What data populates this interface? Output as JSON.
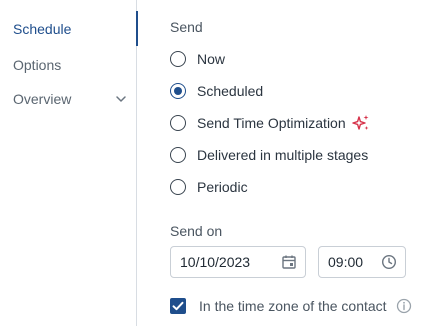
{
  "sidebar": {
    "items": [
      {
        "label": "Schedule",
        "active": true
      },
      {
        "label": "Options",
        "active": false
      },
      {
        "label": "Overview",
        "active": false
      }
    ]
  },
  "send": {
    "label": "Send",
    "options": [
      {
        "label": "Now",
        "checked": false
      },
      {
        "label": "Scheduled",
        "checked": true
      },
      {
        "label": "Send Time Optimization",
        "checked": false,
        "icon": "sparkle-icon"
      },
      {
        "label": "Delivered in multiple stages",
        "checked": false
      },
      {
        "label": "Periodic",
        "checked": false
      }
    ]
  },
  "send_on": {
    "label": "Send on",
    "date": "10/10/2023",
    "time": "09:00",
    "timezone_label": "In the time zone of the contact",
    "timezone_checked": true
  },
  "colors": {
    "accent": "#1f4e8c",
    "sparkle": "#d6324a"
  }
}
